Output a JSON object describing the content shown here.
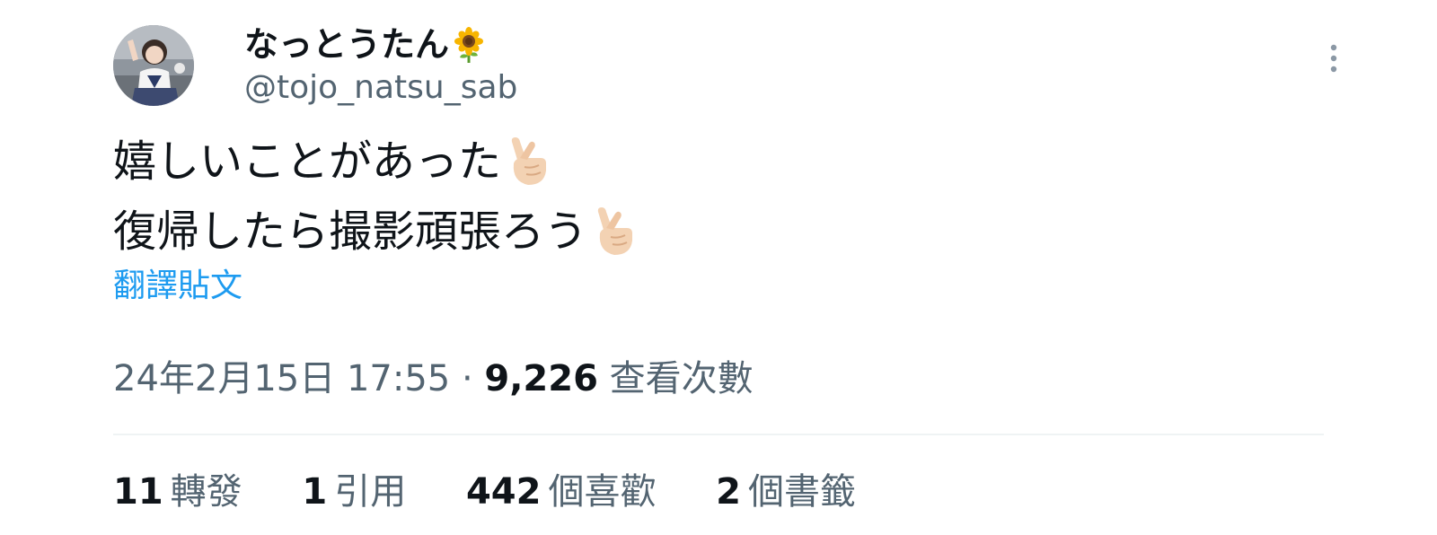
{
  "user": {
    "display_name": "なっとうたん",
    "display_name_emoji": "sunflower-emoji",
    "handle": "@tojo_natsu_sab"
  },
  "tweet": {
    "lines": [
      {
        "text": "嬉しいことがあった",
        "emoji": "finger-heart-emoji"
      },
      {
        "text": "復帰したら撮影頑張ろう",
        "emoji": "finger-heart-emoji"
      }
    ],
    "translate_label": "翻譯貼文"
  },
  "meta": {
    "timestamp": "24年2月15日 17:55",
    "separator": "·",
    "views_count": "9,226",
    "views_label": "查看次數"
  },
  "stats": [
    {
      "count": "11",
      "label": "轉發"
    },
    {
      "count": "1",
      "label": "引用"
    },
    {
      "count": "442",
      "label": "個喜歡"
    },
    {
      "count": "2",
      "label": "個書籤"
    }
  ],
  "icons": {
    "more": "more-vertical-icon"
  },
  "colors": {
    "text_primary": "#0f1419",
    "text_secondary": "#536471",
    "link": "#1d9bf0",
    "divider": "#eff3f4"
  }
}
